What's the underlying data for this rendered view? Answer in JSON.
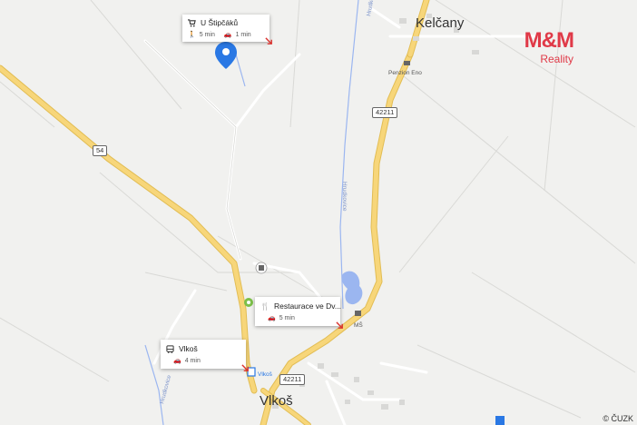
{
  "towns": {
    "kelcany": "Kelčany",
    "vlkos": "Vlkoš"
  },
  "places": {
    "penzion": "Penzion Eno",
    "ms": "MŠ",
    "stream_hrudkovice": "Hrudkovice",
    "stream_vlkos": "Vlkoš"
  },
  "roads": {
    "road_54": "54",
    "road_42211_north": "42211",
    "road_42211_south": "42211"
  },
  "cards": {
    "stipcaku": {
      "title": "U Štipčáků",
      "walk": "5 min",
      "car": "1 min"
    },
    "restaurace": {
      "title": "Restaurace ve Dv...",
      "car": "5 min"
    },
    "vlkos_bus": {
      "title": "Vlkoš",
      "car": "4 min"
    }
  },
  "logo": {
    "main": "M&M",
    "sub": "Reality"
  },
  "attribution": "© ČUZK",
  "colors": {
    "background": "#f1f1ef",
    "road_main": "#f7d67a",
    "road_minor": "#ffffff",
    "water": "#9bb6f0",
    "pin": "#2a78e4",
    "brand": "#e03a48",
    "arrow": "#d9332f"
  },
  "icons": {
    "pin": "location-pin-icon",
    "cart": "cart-icon",
    "fork_knife": "restaurant-icon",
    "bus": "bus-icon",
    "walk": "walk-icon",
    "car": "car-icon",
    "arrow": "arrow-icon"
  }
}
